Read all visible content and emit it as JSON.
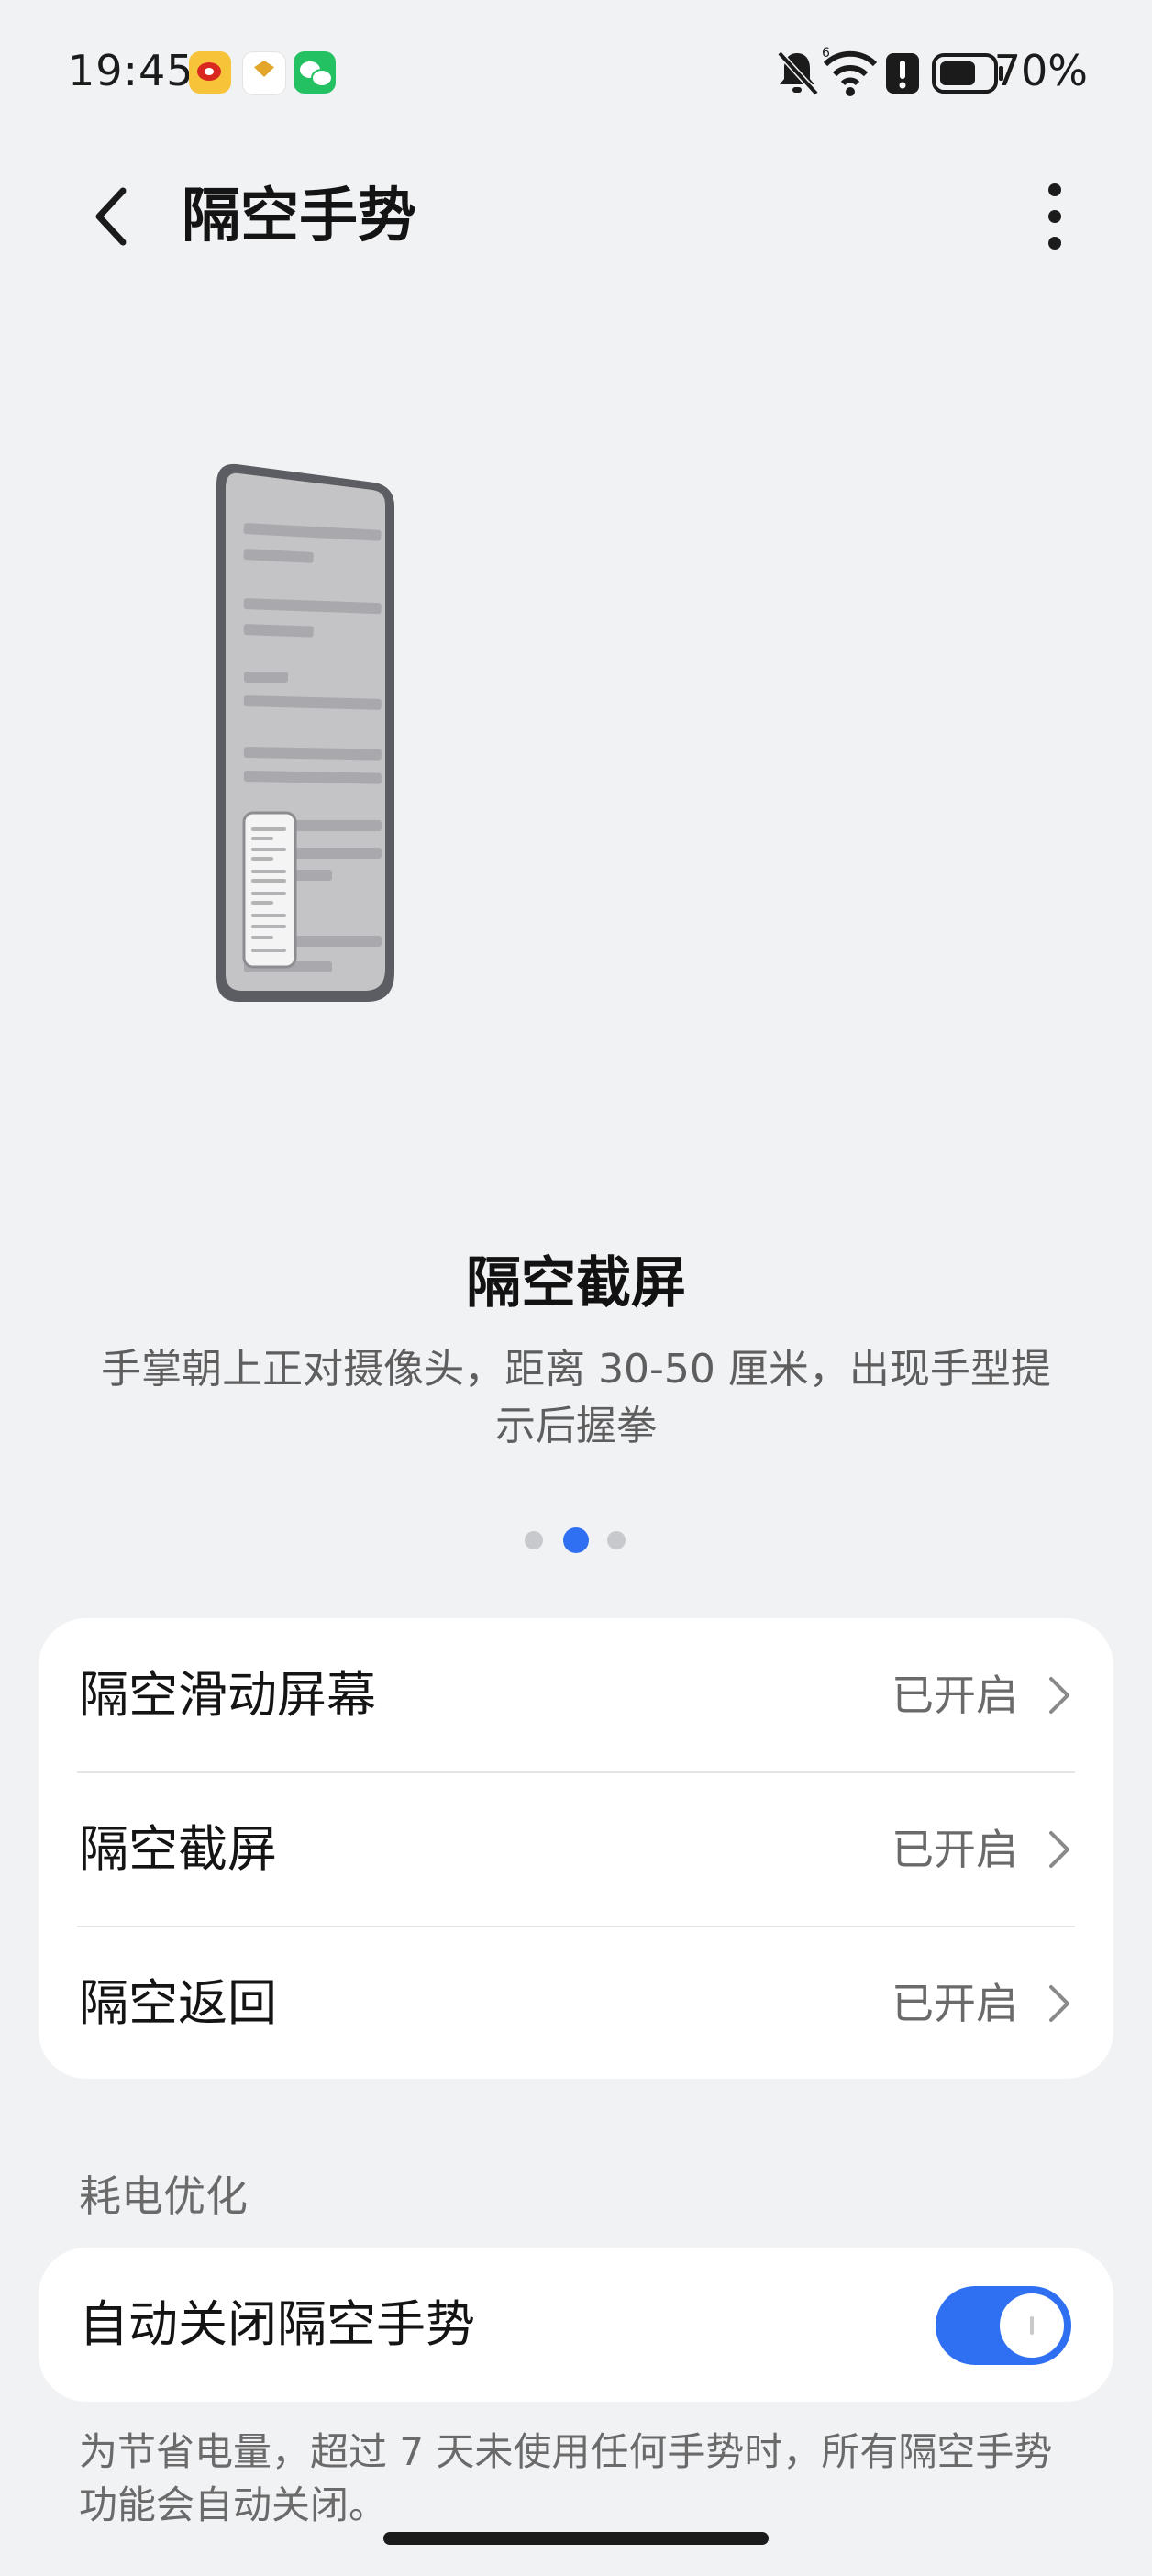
{
  "status_bar": {
    "time": "19:45",
    "notification_icons": [
      "weibo-icon",
      "honor-icon",
      "wechat-icon"
    ],
    "system_icons": [
      "mute-bell-icon",
      "wifi-6-icon",
      "alert-icon",
      "battery-icon"
    ],
    "battery_percent": "70%",
    "battery_level": 0.7
  },
  "header": {
    "back_icon": "chevron-left-icon",
    "title": "隔空手势",
    "more_icon": "more-vertical-icon"
  },
  "carousel": {
    "title": "隔空截屏",
    "description": "手掌朝上正对摄像头，距离 30-50 厘米，出现手型提示后握拳",
    "page_count": 3,
    "active_page": 2
  },
  "gestures": [
    {
      "label": "隔空滑动屏幕",
      "value": "已开启"
    },
    {
      "label": "隔空截屏",
      "value": "已开启"
    },
    {
      "label": "隔空返回",
      "value": "已开启"
    }
  ],
  "power": {
    "section_title": "耗电优化",
    "toggle_label": "自动关闭隔空手势",
    "toggle_on": true,
    "note": "为节省电量，超过 7 天未使用任何手势时，所有隔空手势功能会自动关闭。"
  },
  "colors": {
    "background": "#f1f2f4",
    "accent": "#2f6ff2",
    "card": "#ffffff",
    "secondary_text": "#6a6a6a"
  }
}
